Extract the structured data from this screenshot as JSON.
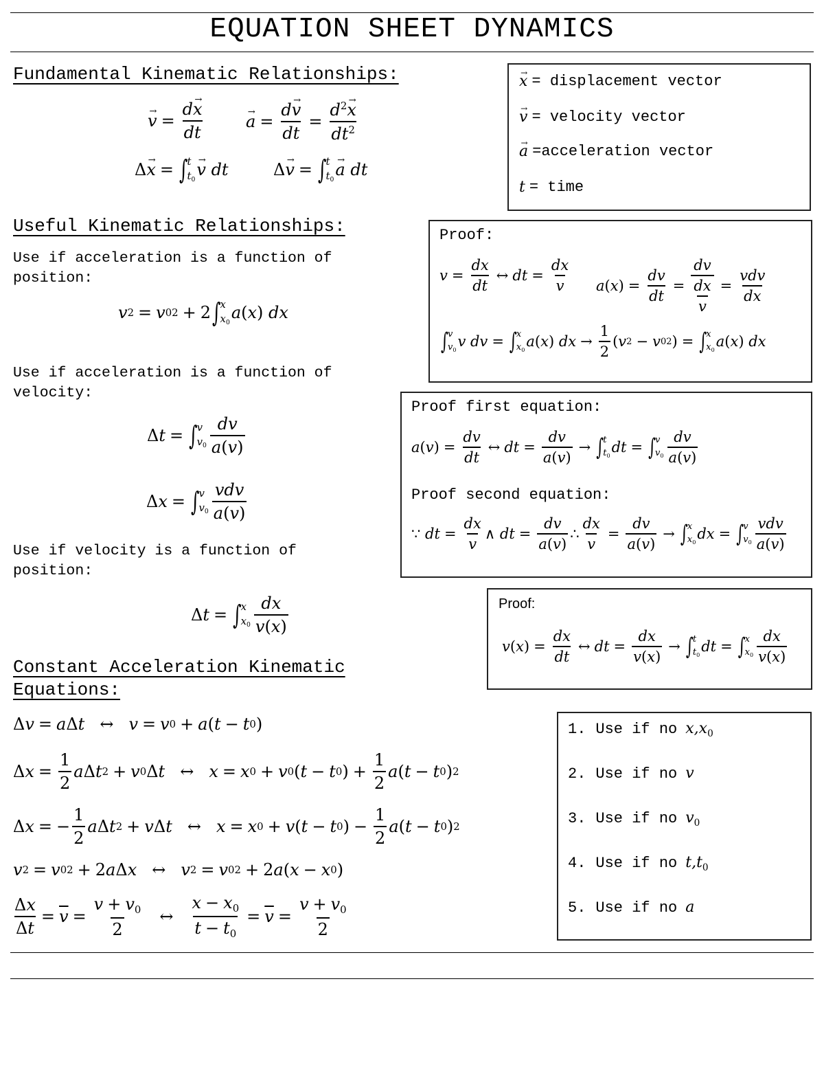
{
  "title": "EQUATION SHEET DYNAMICS",
  "sections": {
    "fundamental": {
      "heading": "Fundamental Kinematic Relationships:",
      "equations": [
        "v⃗ = dx⃗/dt",
        "a⃗ = dv⃗/dt = d²x⃗/dt²",
        "Δx⃗ = ∫_{t0}^{t} v⃗ dt",
        "Δv⃗ = ∫_{t0}^{t} a⃗ dt"
      ]
    },
    "legend": {
      "items": [
        {
          "symbol": "x",
          "text": "= displacement vector"
        },
        {
          "symbol": "v",
          "text": "= velocity vector"
        },
        {
          "symbol": "a",
          "text": "=acceleration vector"
        },
        {
          "symbol": "t",
          "text": "= time"
        }
      ]
    },
    "useful": {
      "heading": "Useful Kinematic Relationships:",
      "note_position": "Use if acceleration is a function of position:",
      "note_velocity": "Use if acceleration is a function of velocity:",
      "note_vel_position": "Use if velocity is a function of position:",
      "equations": [
        "v² = v0² + 2 ∫_{x0}^{x} a(x) dx",
        "Δt = ∫_{v0}^{v} dv/a(v)",
        "Δx = ∫_{v0}^{v} v dv/a(v)",
        "Δt = ∫_{x0}^{x} dx/v(x)"
      ]
    },
    "proof1": {
      "label": "Proof:",
      "equations": [
        "v = dx/dt ↔ dt = dx/v",
        "a(x) = dv/dt = dv/(dx/v) = v dv/dx",
        "∫_{v0}^{v} v dv = ∫_{x0}^{x} a(x) dx → 1/2 (v² − v0²) = ∫_{x0}^{x} a(x) dx"
      ]
    },
    "proof2": {
      "label_first": "Proof first equation:",
      "label_second": "Proof second equation:",
      "equations": [
        "a(v) = dv/dt ↔ dt = dv/a(v) → ∫_{t0}^{t} dt = ∫_{v0}^{v} dv/a(v)",
        "∵ dt = dx/v ∧ dt = dv/a(v) ∴ dx/v = dv/a(v) → ∫_{x0}^{x} dx = ∫_{v0}^{v} v dv/a(v)"
      ]
    },
    "proof3": {
      "label": "Proof:",
      "equations": [
        "v(x) = dx/dt ↔ dt = dx/v(x) → ∫_{t0}^{t} dt = ∫_{x0}^{x} dx/v(x)"
      ]
    },
    "constant": {
      "heading_line1": "Constant Acceleration Kinematic",
      "heading_line2": "Equations:",
      "equations": [
        "Δv = aΔt ↔ v = v0 + a(t − t0)",
        "Δx = 1/2 aΔt² + v0Δt ↔ x = x0 + v0(t − t0) + 1/2 a(t − t0)²",
        "Δx = −1/2 aΔt² + vΔt ↔ x = x0 + v(t − t0) − 1/2 a(t − t0)²",
        "v² = v0² + 2aΔx ↔ v² = v0² + 2a(x − x0)",
        "Δx/Δt = v̄ = (v + v0)/2 ↔ (x − x0)/(t − t0) = v̄ = (v + v0)/2"
      ]
    },
    "usage_list": {
      "items": [
        {
          "number": "1.",
          "text": "Use if no",
          "vars": "x,x0"
        },
        {
          "number": "2.",
          "text": "Use if no",
          "vars": "v"
        },
        {
          "number": "3.",
          "text": "Use if no",
          "vars": "v0"
        },
        {
          "number": "4.",
          "text": "Use if no",
          "vars": "t,t0"
        },
        {
          "number": "5.",
          "text": "Use if no",
          "vars": "a"
        }
      ]
    }
  }
}
